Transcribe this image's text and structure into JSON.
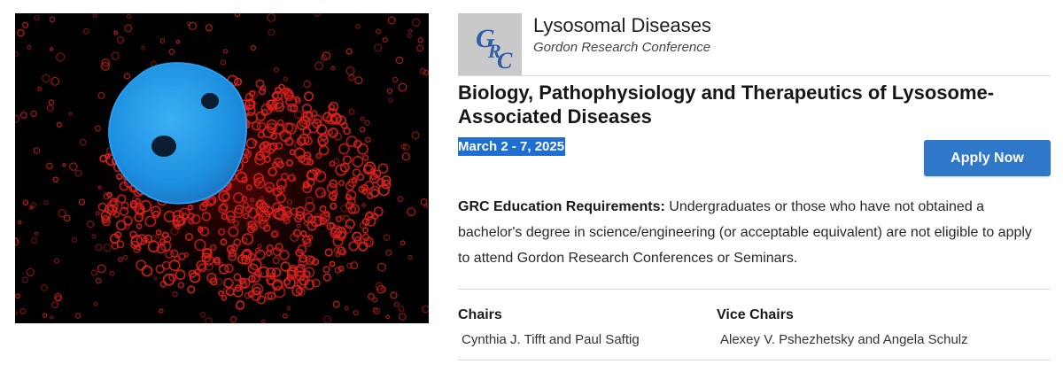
{
  "hero": {
    "alt": "Fluorescence microscopy image of a cell with blue nucleus and red lysosomes",
    "colors": {
      "nucleus": "#1f95e6",
      "lysosome": "#e0201c",
      "background": "#000000"
    }
  },
  "logo": {
    "text": "GRC",
    "bg": "#c9c9c9",
    "text_color": "#2f5da8"
  },
  "conference": {
    "name": "Lysosomal Diseases",
    "subtitle": "Gordon Research Conference"
  },
  "title": "Biology, Pathophysiology and Therapeutics of Lysosome-Associated Diseases",
  "dates": "March 2 - 7, 2025",
  "apply_button": {
    "label": "Apply Now",
    "color": "#2f77c9"
  },
  "education": {
    "label": "GRC Education Requirements:",
    "text": " Undergraduates or those who have not obtained a bachelor's degree in science/engineering (or acceptable equivalent) are not eligible to apply to attend Gordon Research Conferences or Seminars."
  },
  "chairs": {
    "heading": "Chairs",
    "names": "Cynthia J. Tifft  and  Paul Saftig"
  },
  "vice_chairs": {
    "heading": "Vice Chairs",
    "names": "Alexey V. Pshezhetsky  and  Angela Schulz"
  }
}
